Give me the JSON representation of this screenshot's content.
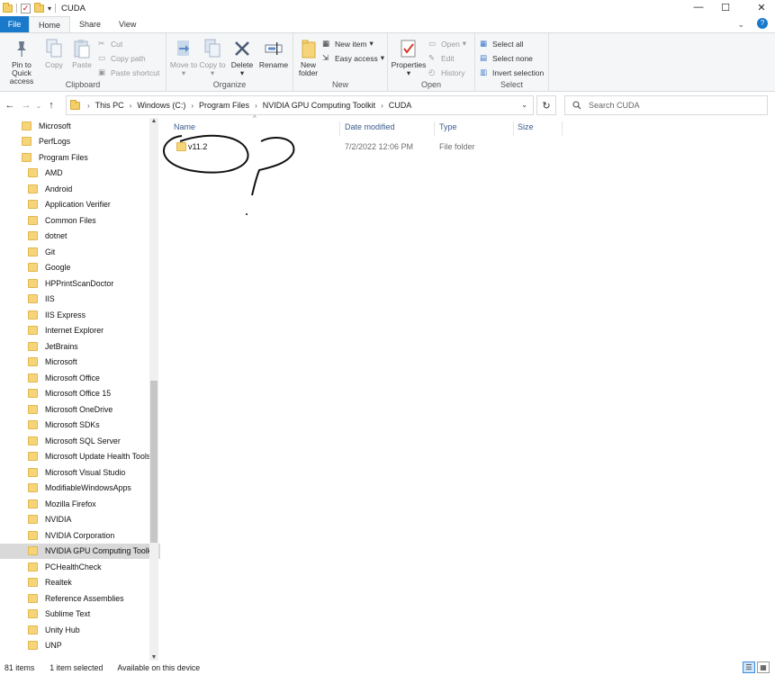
{
  "window": {
    "title": "CUDA",
    "buttons": {
      "minimize": "—",
      "maximize": "☐",
      "close": "✕"
    }
  },
  "ribbon_tabs": [
    "File",
    "Home",
    "Share",
    "View"
  ],
  "ribbon": {
    "clipboard": {
      "label": "Clipboard",
      "pin": "Pin to Quick access",
      "copy": "Copy",
      "paste": "Paste",
      "cut": "Cut",
      "copy_path": "Copy path",
      "paste_shortcut": "Paste shortcut"
    },
    "organize": {
      "label": "Organize",
      "move_to": "Move to",
      "copy_to": "Copy to",
      "delete": "Delete",
      "rename": "Rename"
    },
    "new": {
      "label": "New",
      "new_folder": "New folder",
      "new_item": "New item",
      "easy_access": "Easy access"
    },
    "open": {
      "label": "Open",
      "properties": "Properties",
      "open": "Open",
      "edit": "Edit",
      "history": "History"
    },
    "select": {
      "label": "Select",
      "select_all": "Select all",
      "select_none": "Select none",
      "invert": "Invert selection"
    }
  },
  "address": {
    "crumbs": [
      "This PC",
      "Windows (C:)",
      "Program Files",
      "NVIDIA GPU Computing Toolkit",
      "CUDA"
    ],
    "search_placeholder": "Search CUDA"
  },
  "nav_tree": [
    {
      "label": "Microsoft",
      "level": 0
    },
    {
      "label": "PerfLogs",
      "level": 0
    },
    {
      "label": "Program Files",
      "level": 0
    },
    {
      "label": "AMD",
      "level": 1
    },
    {
      "label": "Android",
      "level": 1
    },
    {
      "label": "Application Verifier",
      "level": 1
    },
    {
      "label": "Common Files",
      "level": 1
    },
    {
      "label": "dotnet",
      "level": 1
    },
    {
      "label": "Git",
      "level": 1
    },
    {
      "label": "Google",
      "level": 1
    },
    {
      "label": "HPPrintScanDoctor",
      "level": 1
    },
    {
      "label": "IIS",
      "level": 1
    },
    {
      "label": "IIS Express",
      "level": 1
    },
    {
      "label": "Internet Explorer",
      "level": 1
    },
    {
      "label": "JetBrains",
      "level": 1
    },
    {
      "label": "Microsoft",
      "level": 1
    },
    {
      "label": "Microsoft Office",
      "level": 1
    },
    {
      "label": "Microsoft Office 15",
      "level": 1
    },
    {
      "label": "Microsoft OneDrive",
      "level": 1
    },
    {
      "label": "Microsoft SDKs",
      "level": 1
    },
    {
      "label": "Microsoft SQL Server",
      "level": 1
    },
    {
      "label": "Microsoft Update Health Tools",
      "level": 1
    },
    {
      "label": "Microsoft Visual Studio",
      "level": 1
    },
    {
      "label": "ModifiableWindowsApps",
      "level": 1
    },
    {
      "label": "Mozilla Firefox",
      "level": 1
    },
    {
      "label": "NVIDIA",
      "level": 1
    },
    {
      "label": "NVIDIA Corporation",
      "level": 1
    },
    {
      "label": "NVIDIA GPU Computing Toolkit",
      "level": 1,
      "selected": true
    },
    {
      "label": "PCHealthCheck",
      "level": 1
    },
    {
      "label": "Realtek",
      "level": 1
    },
    {
      "label": "Reference Assemblies",
      "level": 1
    },
    {
      "label": "Sublime Text",
      "level": 1
    },
    {
      "label": "Unity Hub",
      "level": 1
    },
    {
      "label": "UNP",
      "level": 1
    }
  ],
  "columns": {
    "name": "Name",
    "date": "Date modified",
    "type": "Type",
    "size": "Size"
  },
  "files": [
    {
      "name": "v11.2",
      "date": "7/2/2022 12:06 PM",
      "type": "File folder",
      "size": ""
    }
  ],
  "status": {
    "items": "81 items",
    "selected": "1 item selected",
    "availability": "Available on this device"
  },
  "colors": {
    "accent": "#1979ca",
    "folder": "#f6d57a",
    "selected_bg": "#d9d9d9"
  }
}
